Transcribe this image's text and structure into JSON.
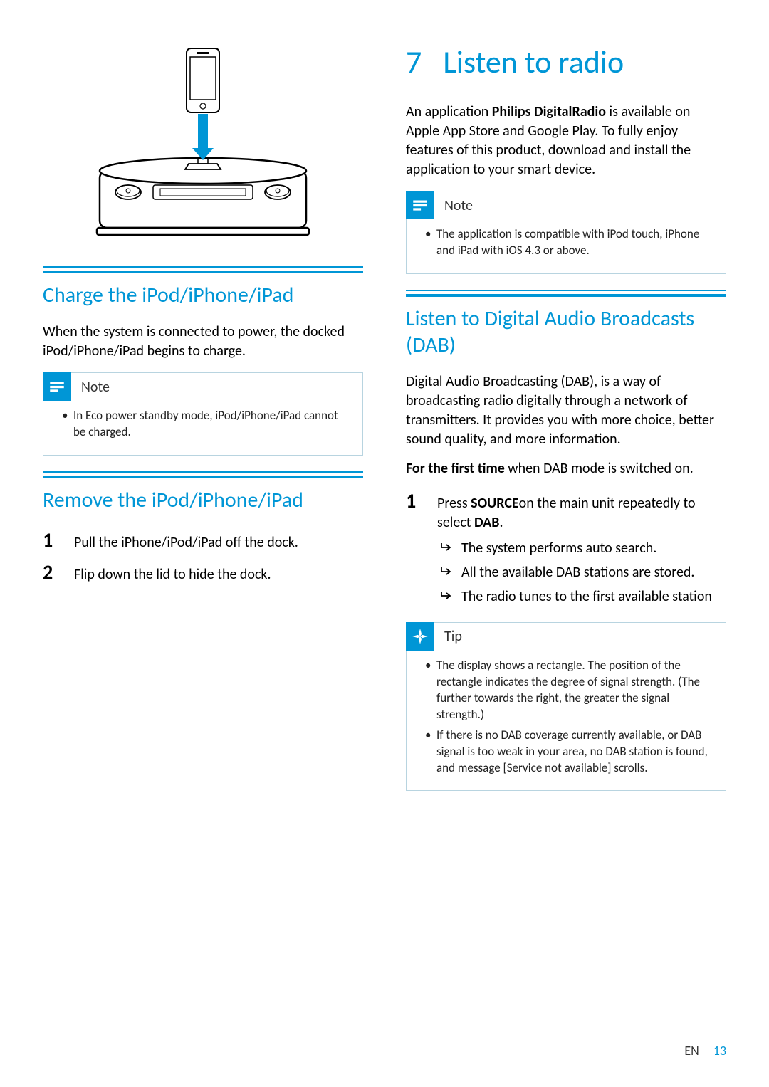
{
  "chapter": {
    "number": "7",
    "title": "Listen to radio"
  },
  "left": {
    "h2_charge": "Charge the iPod/iPhone/iPad",
    "charge_body": "When the system is connected to power, the docked iPod/iPhone/iPad begins to charge.",
    "charge_note_title": "Note",
    "charge_note_item1": "In Eco power standby mode, iPod/iPhone/iPad cannot be charged.",
    "h2_remove": "Remove the iPod/iPhone/iPad",
    "remove_steps": [
      {
        "num": "1",
        "txt": "Pull the iPhone/iPod/iPad off the dock."
      },
      {
        "num": "2",
        "txt": "Flip down the lid to hide the dock."
      }
    ]
  },
  "right": {
    "intro_pre": "An application ",
    "intro_bold": "Philips DigitalRadio",
    "intro_post": " is available on Apple App Store and Google Play. To fully enjoy features of this product, download and install the application to your smart device.",
    "app_note_title": "Note",
    "app_note_item1": "The application is compatible with iPod touch, iPhone and iPad with iOS 4.3 or above.",
    "h2_dab": "Listen to Digital Audio Broadcasts (DAB)",
    "dab_body": "Digital Audio Broadcasting (DAB), is a way of broadcasting radio digitally through a network of transmitters. It provides you with more choice, better sound quality, and more information.",
    "first_time_bold": "For the first time",
    "first_time_post": " when DAB mode is switched on.",
    "dab_step_num": "1",
    "dab_step_pre": "Press ",
    "dab_step_source": "SOURCE",
    "dab_step_mid": "on the main unit repeatedly to select ",
    "dab_step_dab": "DAB",
    "dab_step_post": ".",
    "dab_results": [
      "The system performs auto search.",
      "All the available DAB stations are stored.",
      "The radio tunes to the first available station"
    ],
    "tip_title": "Tip",
    "tip_items": [
      "The display shows a rectangle. The position of the rectangle indicates the degree of signal strength. (The further towards the right, the greater the signal strength.)",
      "If there is no DAB coverage currently available, or DAB signal is too weak in your area, no DAB station is found, and message [Service not available] scrolls."
    ]
  },
  "footer": {
    "lang": "EN",
    "page": "13"
  }
}
